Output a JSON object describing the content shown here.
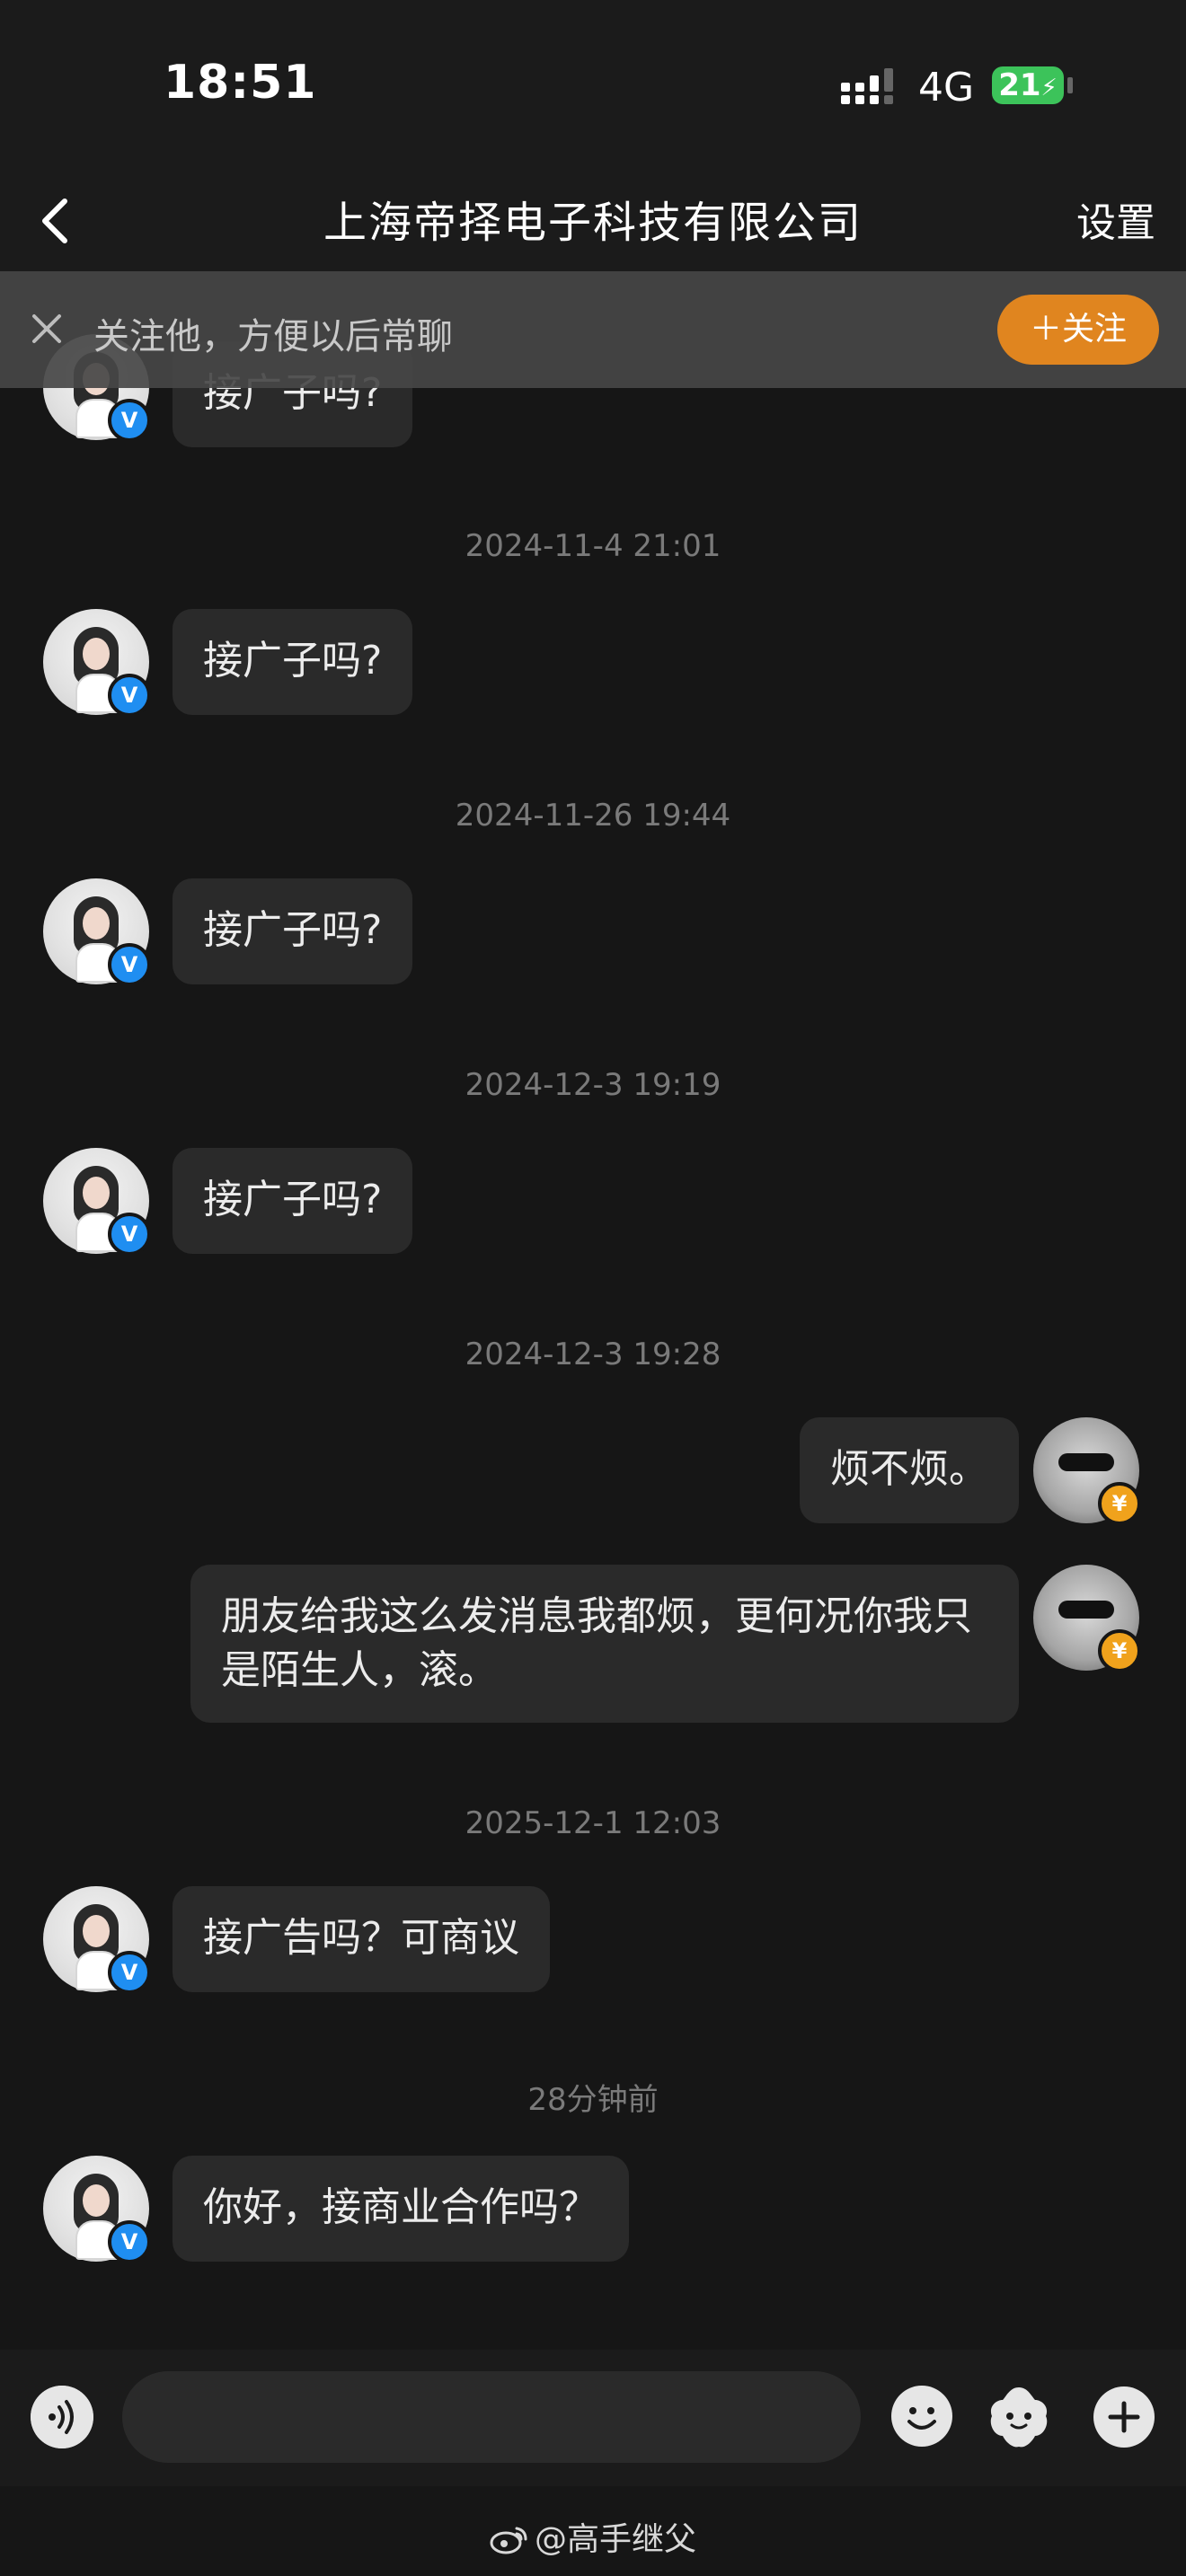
{
  "status_bar": {
    "time": "18:51",
    "network": "4G",
    "battery": "21"
  },
  "nav": {
    "title": "上海帝择电子科技有限公司",
    "settings_label": "设置"
  },
  "follow_banner": {
    "text": "关注他，方便以后常聊",
    "follow_label": "＋关注"
  },
  "messages": [
    {
      "timestamp": "2024-11-4 21:01",
      "from": "them",
      "text": "接广子吗?"
    },
    {
      "timestamp": "2024-11-26 19:44",
      "from": "them",
      "text": "接广子吗?"
    },
    {
      "timestamp": "2024-12-3 19:19",
      "from": "them",
      "text": "接广子吗?"
    },
    {
      "timestamp": "2024-12-3 19:28",
      "from": "me",
      "text": "烦不烦。"
    },
    {
      "from": "me",
      "text": "朋友给我这么发消息我都烦，更何况你我只是陌生人，滚。"
    },
    {
      "timestamp": "2025-12-1 12:03",
      "from": "them",
      "text": "接广告吗？可商议"
    },
    {
      "timestamp": "28分钟前",
      "from": "them",
      "text": "你好，接商业合作吗？"
    }
  ],
  "partial_top_message": {
    "text": "接广子吗?"
  },
  "badges": {
    "verified": "V",
    "vip": "¥"
  },
  "input_bar": {
    "placeholder": ""
  },
  "footer": {
    "watermark": "@高手继父"
  },
  "colors": {
    "background": "#161616",
    "bubble": "#2a2a2a",
    "follow_button": "#e0851f",
    "verified_badge": "#1f8ef1",
    "vip_badge": "#f0a21c",
    "battery": "#3cc35a"
  }
}
